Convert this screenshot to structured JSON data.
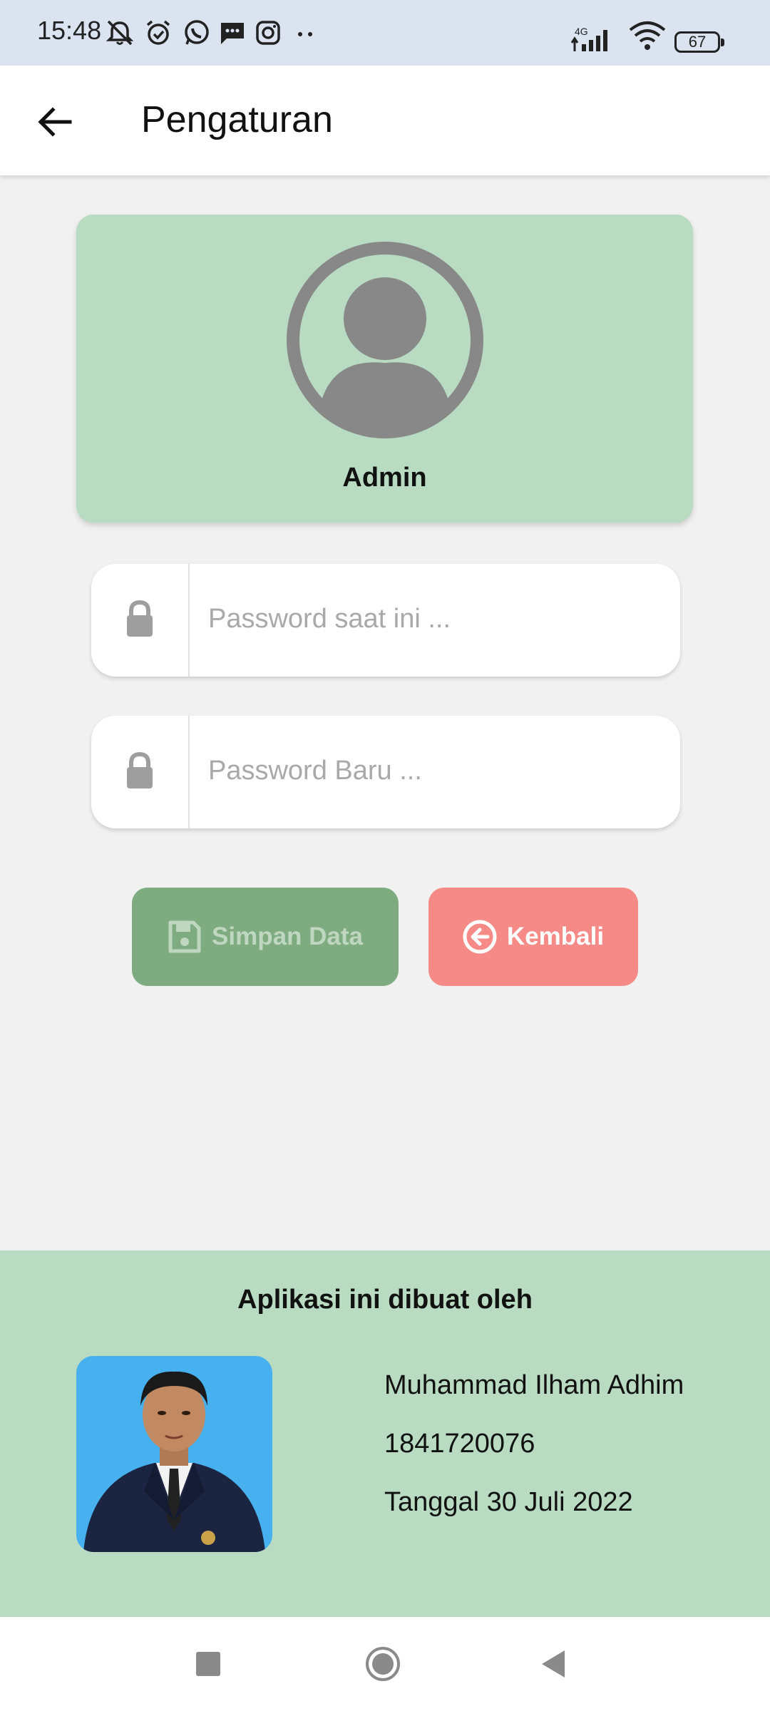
{
  "status_bar": {
    "time": "15:48",
    "network": "4G",
    "battery": "67",
    "icons": [
      "mute-icon",
      "alarm-icon",
      "whatsapp-icon",
      "message-icon",
      "instagram-icon",
      "more-dots-icon",
      "signal-icon",
      "wifi-icon",
      "battery-icon"
    ]
  },
  "app_bar": {
    "title": "Pengaturan",
    "back_icon": "arrow-left-icon"
  },
  "profile": {
    "name": "Admin",
    "avatar_icon": "user-avatar-icon"
  },
  "form": {
    "current_password_placeholder": "Password saat ini ...",
    "new_password_placeholder": "Password Baru ...",
    "field_icon": "lock-icon"
  },
  "buttons": {
    "save_label": "Simpan Data",
    "save_icon": "floppy-disk-icon",
    "back_label": "Kembali",
    "back_icon": "circle-arrow-left-icon"
  },
  "footer": {
    "heading": "Aplikasi ini dibuat oleh",
    "author_name": "Muhammad Ilham Adhim",
    "author_id": "1841720076",
    "date": "Tanggal 30 Juli 2022"
  },
  "nav_bar": {
    "icons": [
      "recent-apps-icon",
      "home-icon",
      "back-triangle-icon"
    ]
  },
  "colors": {
    "status_bar_bg": "#dbe3f1",
    "card_green": "#b8dbc2",
    "save_button": "#7eab7f",
    "back_button": "#f68a86",
    "page_bg": "#f1f1f1"
  }
}
